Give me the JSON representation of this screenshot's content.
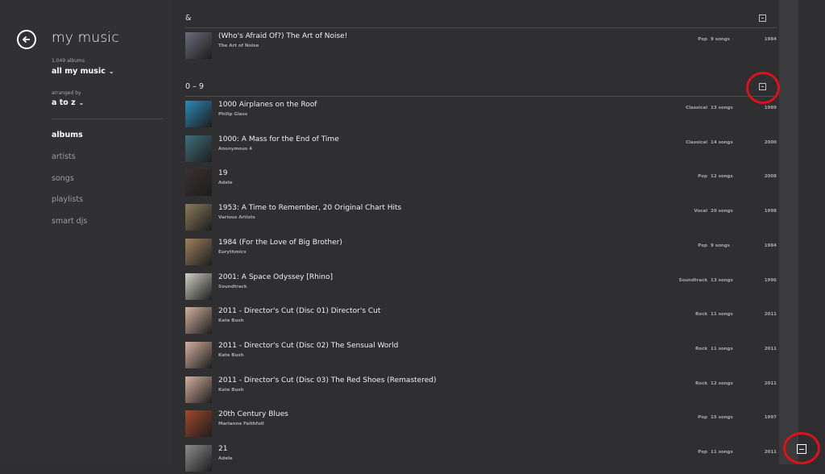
{
  "app": {
    "title": "my music"
  },
  "library": {
    "count_caption": "1,049 albums",
    "filter": "all my music",
    "arranged_caption": "arranged by",
    "arranged_value": "a to z"
  },
  "nav": {
    "items": [
      {
        "label": "albums",
        "active": true
      },
      {
        "label": "artists",
        "active": false
      },
      {
        "label": "songs",
        "active": false
      },
      {
        "label": "playlists",
        "active": false
      },
      {
        "label": "smart djs",
        "active": false
      }
    ]
  },
  "groups": [
    {
      "header": "&",
      "albums": [
        {
          "title": "(Who's Afraid Of?) The Art of Noise!",
          "artist": "The Art of Noise",
          "genre": "Pop",
          "songs": "9 songs",
          "year": "1984",
          "art": "#6b6b7a"
        }
      ]
    },
    {
      "header": "0 – 9",
      "albums": [
        {
          "title": "1000 Airplanes on the Roof",
          "artist": "Philip Glass",
          "genre": "Classical",
          "songs": "13 songs",
          "year": "1989",
          "art": "#2a89b5"
        },
        {
          "title": "1000: A Mass for the End of Time",
          "artist": "Anonymous 4",
          "genre": "Classical",
          "songs": "14 songs",
          "year": "2000",
          "art": "#3f6f7a"
        },
        {
          "title": "19",
          "artist": "Adele",
          "genre": "Pop",
          "songs": "12 songs",
          "year": "2008",
          "art": "#3a3030"
        },
        {
          "title": "1953: A Time to Remember, 20 Original Chart Hits",
          "artist": "Various Artists",
          "genre": "Vocal",
          "songs": "20 songs",
          "year": "1998",
          "art": "#8a7a5a"
        },
        {
          "title": "1984 (For the Love of Big Brother)",
          "artist": "Eurythmics",
          "genre": "Pop",
          "songs": "9 songs",
          "year": "1984",
          "art": "#a08060"
        },
        {
          "title": "2001: A Space Odyssey [Rhino]",
          "artist": "Soundtrack",
          "genre": "Soundtrack",
          "songs": "13 songs",
          "year": "1996",
          "art": "#cfcfc4"
        },
        {
          "title": "2011 - Director's Cut (Disc 01) Director's Cut",
          "artist": "Kate Bush",
          "genre": "Rock",
          "songs": "11 songs",
          "year": "2011",
          "art": "#d4b0a0"
        },
        {
          "title": "2011 - Director's Cut (Disc 02) The Sensual World",
          "artist": "Kate Bush",
          "genre": "Rock",
          "songs": "11 songs",
          "year": "2011",
          "art": "#d4b0a0"
        },
        {
          "title": "2011 - Director's Cut (Disc 03) The Red Shoes (Remastered)",
          "artist": "Kate Bush",
          "genre": "Rock",
          "songs": "12 songs",
          "year": "2011",
          "art": "#d4b0a0"
        },
        {
          "title": "20th Century Blues",
          "artist": "Marianne Faithfull",
          "genre": "Pop",
          "songs": "15 songs",
          "year": "1997",
          "art": "#a0482a"
        },
        {
          "title": "21",
          "artist": "Adele",
          "genre": "Pop",
          "songs": "11 songs",
          "year": "2011",
          "art": "#8c8c8c"
        }
      ]
    }
  ],
  "colors": {
    "annotation": "#e0101a",
    "background": "#2e2e30"
  }
}
